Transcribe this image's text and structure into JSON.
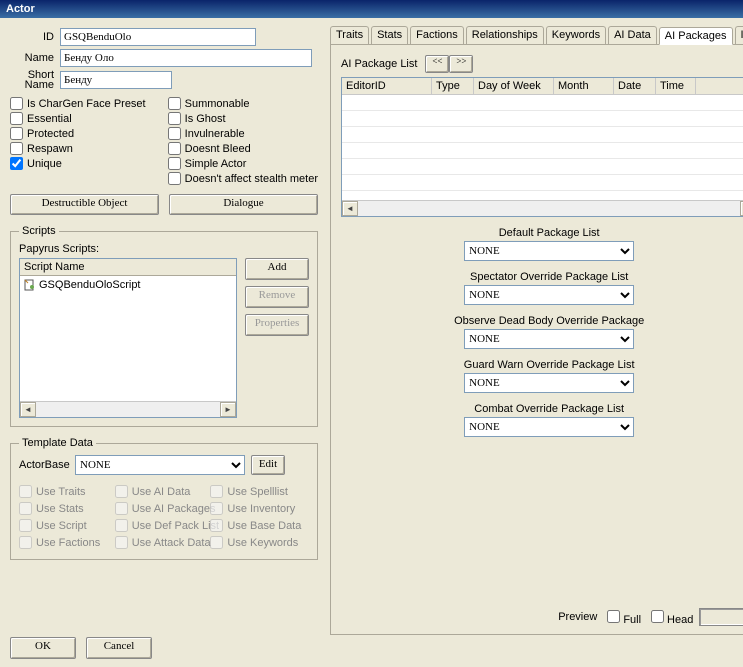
{
  "window": {
    "title": "Actor"
  },
  "idrow": {
    "label": "ID",
    "value": "GSQBenduOlo"
  },
  "namerow": {
    "label": "Name",
    "value": "Бенду Оло"
  },
  "shortnamerow": {
    "label": "Short Name",
    "value": "Бенду"
  },
  "flagsL": {
    "chargen": "Is CharGen Face Preset",
    "essential": "Essential",
    "protected": "Protected",
    "respawn": "Respawn",
    "unique": "Unique"
  },
  "flagsR": {
    "summonable": "Summonable",
    "ghost": "Is Ghost",
    "invuln": "Invulnerable",
    "nobleed": "Doesnt Bleed",
    "simple": "Simple Actor",
    "stealth": "Doesn't affect stealth meter"
  },
  "buttons": {
    "destructible": "Destructible Object",
    "dialogue": "Dialogue",
    "add": "Add",
    "remove": "Remove",
    "properties": "Properties",
    "edit": "Edit",
    "ok": "OK",
    "cancel": "Cancel"
  },
  "scripts": {
    "legend": "Scripts",
    "caption": "Papyrus Scripts:",
    "col": "Script Name",
    "items": [
      "GSQBenduOloScript"
    ]
  },
  "template": {
    "legend": "Template Data",
    "actorbase_label": "ActorBase",
    "actorbase_value": "NONE",
    "useTraits": "Use Traits",
    "useStats": "Use Stats",
    "useScript": "Use Script",
    "useFactions": "Use Factions",
    "useAIData": "Use AI Data",
    "useAIPackages": "Use AI Packages",
    "useDefPack": "Use Def Pack List",
    "useAttack": "Use Attack Data",
    "useSpelllist": "Use Spelllist",
    "useInventory": "Use Inventory",
    "useBaseData": "Use Base Data",
    "useKeywords": "Use Keywords"
  },
  "tabs": [
    "Traits",
    "Stats",
    "Factions",
    "Relationships",
    "Keywords",
    "AI Data",
    "AI Packages",
    "Inve"
  ],
  "activeTab": "AI Packages",
  "aiPkg": {
    "listLabel": "AI Package List",
    "nav_prev": "<<",
    "nav_next": ">>",
    "cols": [
      "EditorID",
      "Type",
      "Day of Week",
      "Month",
      "Date",
      "Time"
    ],
    "selectors": [
      {
        "caption": "Default Package List",
        "value": "NONE"
      },
      {
        "caption": "Spectator Override Package List",
        "value": "NONE"
      },
      {
        "caption": "Observe Dead Body Override Package",
        "value": "NONE"
      },
      {
        "caption": "Guard Warn Override Package List",
        "value": "NONE"
      },
      {
        "caption": "Combat Override Package List",
        "value": "NONE"
      }
    ]
  },
  "preview": {
    "label": "Preview",
    "full": "Full",
    "head": "Head"
  }
}
